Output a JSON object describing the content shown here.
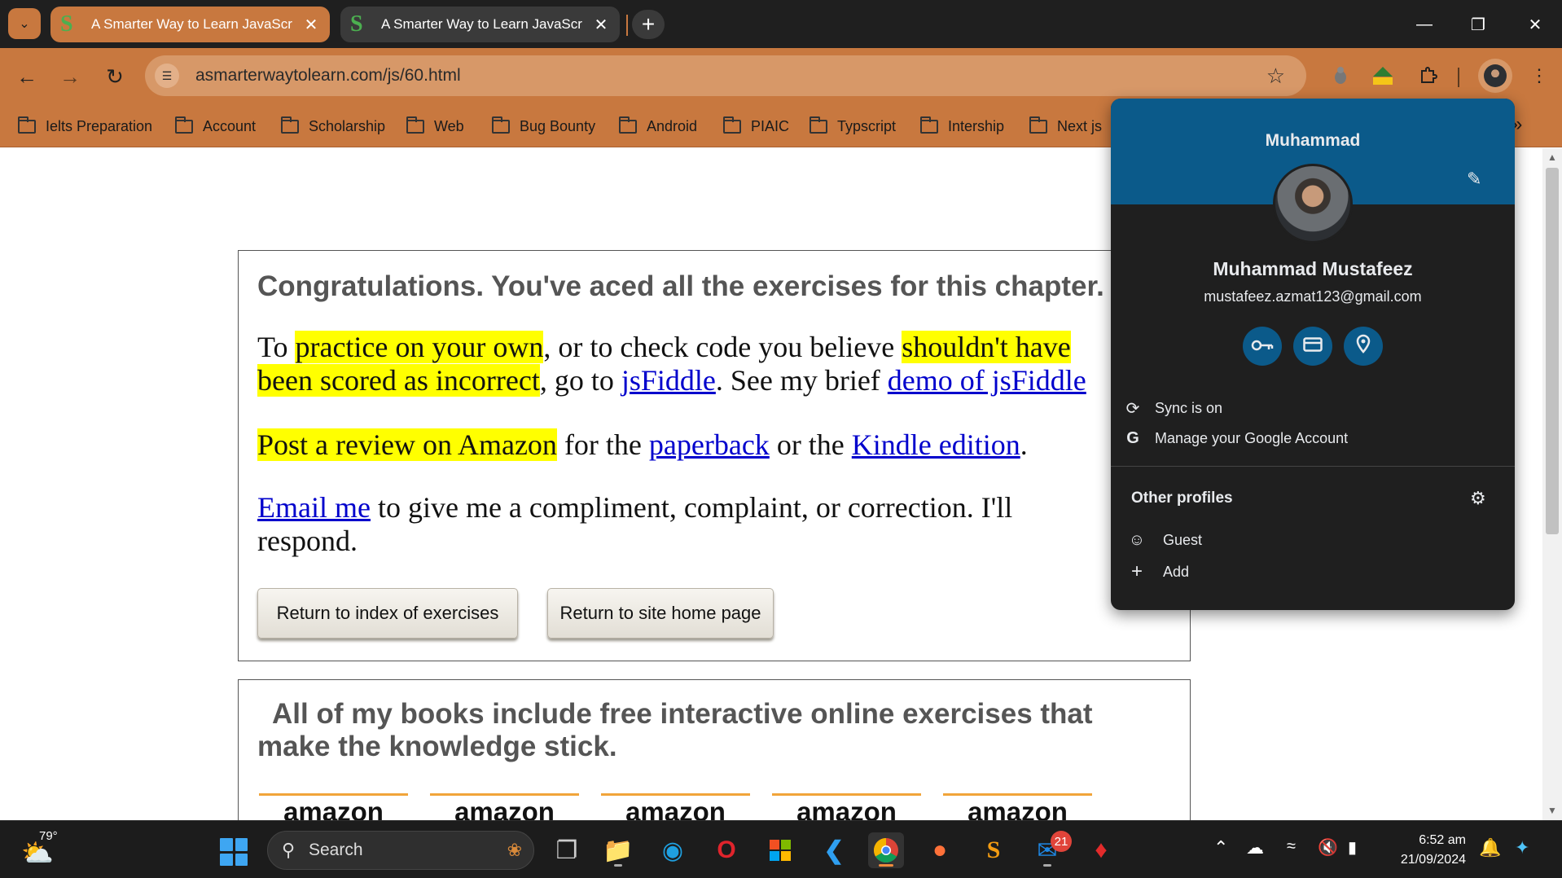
{
  "tabs": [
    {
      "title": "A Smarter Way to Learn JavaScr",
      "favicon": "S",
      "active": true
    },
    {
      "title": "A Smarter Way to Learn JavaScr",
      "favicon": "S",
      "active": false
    }
  ],
  "toolbar": {
    "url": "asmarterwaytolearn.com/js/60.html"
  },
  "bookmarks": [
    "Ielts Preparation",
    "Account",
    "Scholarship",
    "Web",
    "Bug Bounty",
    "Android",
    "PIAIC",
    "Typscript",
    "Intership",
    "Next js"
  ],
  "page": {
    "congrats": "Congratulations. You've aced all the exercises for this chapter.",
    "p1": {
      "t1": "To ",
      "h1": "practice on your own",
      "t2": ", or to check code you believe ",
      "h2": "shouldn't have",
      "h3": "been scored as incorrect",
      "t3": ", go to ",
      "l1": "jsFiddle",
      "t4": ". See my brief ",
      "l2": "demo of jsFiddle"
    },
    "p2": {
      "h1": "Post a review on Amazon",
      "t1": " for the ",
      "l1": "paperback",
      "t2": " or the ",
      "l2": "Kindle edition",
      "t3": "."
    },
    "p3": {
      "l1": "Email me",
      "t1": " to give me a compliment, complaint, or correction. I'll respond."
    },
    "btn_index": "Return to index of exercises",
    "btn_home": "Return to site home page",
    "books_heading": "All of my books include free interactive online exercises that make the knowledge stick.",
    "amazon_label": "amazon"
  },
  "profile": {
    "band_name": "Muhammad",
    "full_name": "Muhammad Mustafeez",
    "email": "mustafeez.azmat123@gmail.com",
    "sync": "Sync is on",
    "manage": "Manage your Google Account",
    "other_profiles": "Other profiles",
    "guest": "Guest",
    "add": "Add"
  },
  "taskbar": {
    "temperature": "79°",
    "search_label": "Search",
    "badge_count": "21",
    "time": "6:52 am",
    "date": "21/09/2024"
  },
  "colors": {
    "chrome_accent": "#c8783f",
    "profile_band": "#0b5a8a",
    "highlight": "#ffff00",
    "link": "#0000cc"
  }
}
